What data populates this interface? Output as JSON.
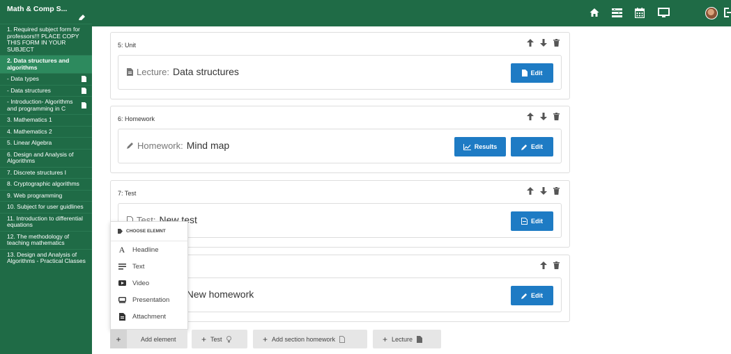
{
  "sidebar": {
    "title": "Math & Comp S...",
    "items": [
      {
        "label": "1. Required subject form for professors!!! PLACE COPY THIS FORM IN YOUR SUBJECT",
        "doc": false,
        "active": false
      },
      {
        "label": "2. Data structures and algorithms",
        "doc": false,
        "active": true
      },
      {
        "label": "- Data types",
        "doc": true,
        "active": false
      },
      {
        "label": "- Data structures",
        "doc": true,
        "active": false
      },
      {
        "label": "- Introduction- Algorithms and programming in C",
        "doc": true,
        "active": false
      },
      {
        "label": "3. Mathematics 1",
        "doc": false,
        "active": false
      },
      {
        "label": "4. Mathematics 2",
        "doc": false,
        "active": false
      },
      {
        "label": "5. Linear Algebra",
        "doc": false,
        "active": false
      },
      {
        "label": "6. Design and Analysis of Algorithms",
        "doc": false,
        "active": false
      },
      {
        "label": "7. Discrete structures I",
        "doc": false,
        "active": false
      },
      {
        "label": "8. Cryptographic algorithms",
        "doc": false,
        "active": false
      },
      {
        "label": "9. Web programming",
        "doc": false,
        "active": false
      },
      {
        "label": "10. Subject for user guidlines",
        "doc": false,
        "active": false
      },
      {
        "label": "11. Introduction to differential equations",
        "doc": false,
        "active": false
      },
      {
        "label": "12. The methodology of teaching mathematics",
        "doc": false,
        "active": false
      },
      {
        "label": "13. Design and Analysis of Algorithms - Practical Classes",
        "doc": false,
        "active": false
      }
    ]
  },
  "colors": {
    "sidebar": "#1f6b46",
    "active_item": "#2d8a5e",
    "button": "#1e7bc4"
  },
  "sections": [
    {
      "title": "5: Unit",
      "kind": "Lecture:",
      "name": "Data structures"
    },
    {
      "title": "6: Homework",
      "kind": "Homework:",
      "name": "Mind map"
    },
    {
      "title": "7: Test",
      "kind": "Test:",
      "name": "New test"
    },
    {
      "title": "",
      "kind": "Homework:",
      "name": "New homework"
    }
  ],
  "buttons": {
    "edit": "Edit",
    "results": "Results"
  },
  "dropdown": {
    "header": "CHOOSE ELEMNT",
    "items": [
      {
        "icon": "headline-icon",
        "label": "Headline"
      },
      {
        "icon": "text-icon",
        "label": "Text"
      },
      {
        "icon": "video-icon",
        "label": "Video"
      },
      {
        "icon": "presentation-icon",
        "label": "Presentation"
      },
      {
        "icon": "attachment-icon",
        "label": "Attachment"
      }
    ]
  },
  "bottom": {
    "add_element": "Add element",
    "test": "Test",
    "section_homework": "Add section homework",
    "lecture": "Lecture"
  }
}
